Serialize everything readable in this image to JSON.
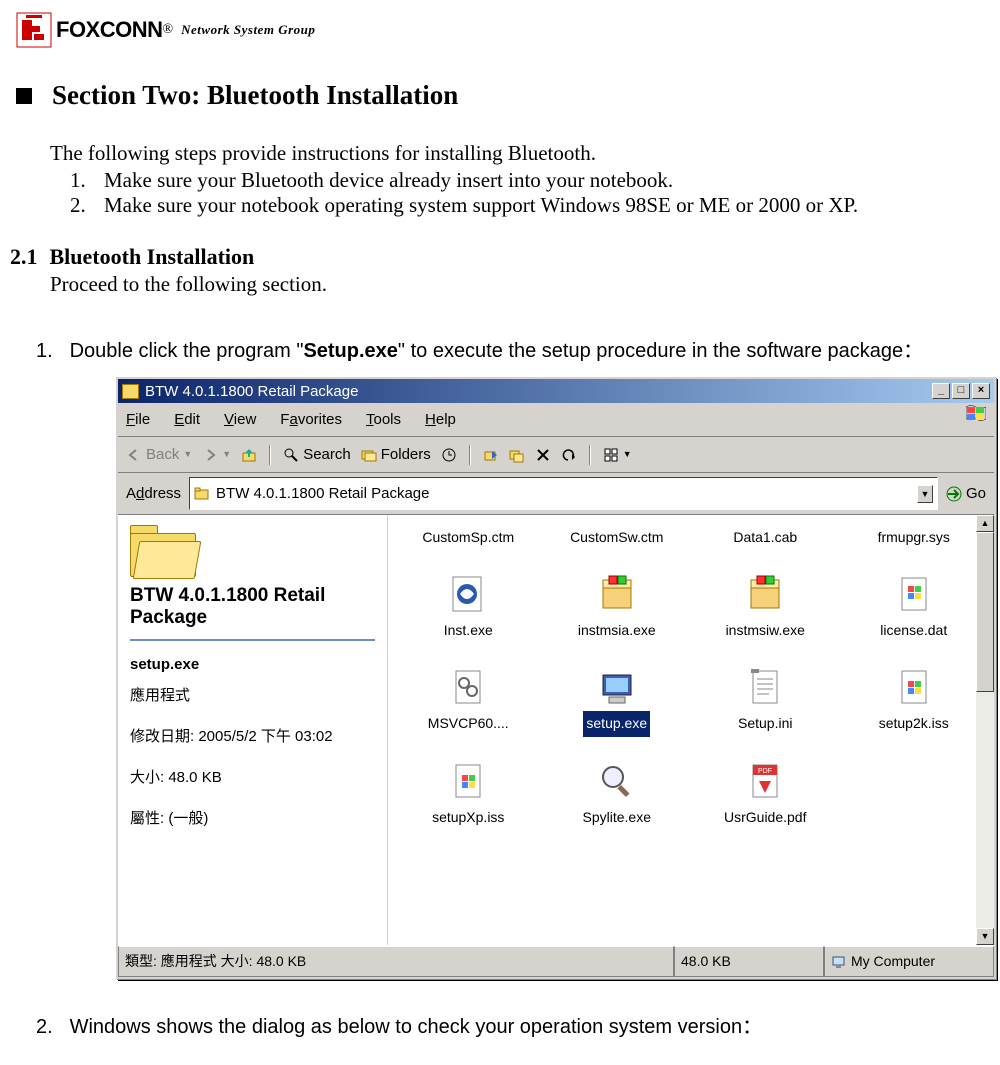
{
  "brand": {
    "name": "FOXCONN",
    "reg": "®",
    "sub": "Network  System  Group"
  },
  "section_title": "Section Two: Bluetooth Installation",
  "intro": "The following steps provide instructions for installing Bluetooth.",
  "prechecks": [
    {
      "n": "1.",
      "t": "Make sure your Bluetooth device already insert into your notebook."
    },
    {
      "n": "2.",
      "t": "Make sure your notebook operating system support Windows 98SE or ME or 2000 or XP."
    }
  ],
  "sub": {
    "num": "2.1",
    "title": "Bluetooth Installation",
    "proceed": "Proceed to the following section."
  },
  "steps": {
    "one": {
      "n": "1.",
      "pre": "Double click the program \"",
      "strong": "Setup.exe",
      "post": "\" to execute the setup procedure in the software package："
    },
    "two": {
      "n": "2.",
      "t": "Windows shows the dialog as below to check your operation system version："
    }
  },
  "win": {
    "title": "BTW 4.0.1.1800 Retail Package",
    "window_buttons": {
      "min": "_",
      "max": "□",
      "close": "×"
    },
    "menus": [
      "File",
      "Edit",
      "View",
      "Favorites",
      "Tools",
      "Help"
    ],
    "toolbar": {
      "back": "Back",
      "search": "Search",
      "folders": "Folders"
    },
    "address": {
      "label": "Address",
      "path": "BTW 4.0.1.1800 Retail Package",
      "go": "Go",
      "drop": "▼"
    },
    "sidepanel": {
      "folder_name": "BTW 4.0.1.1800 Retail Package",
      "sel_name": "setup.exe",
      "sel_type": "應用程式",
      "mod_label": "修改日期: 2005/5/2 下午 03:02",
      "size_label": "大小: 48.0 KB",
      "attr_label": "屬性: (一般)"
    },
    "files_row1": [
      "CustomSp.ctm",
      "CustomSw.ctm",
      "Data1.cab",
      "frmupgr.sys"
    ],
    "files_row2": [
      "Inst.exe",
      "instmsia.exe",
      "instmsiw.exe",
      "license.dat"
    ],
    "files_row3": [
      "MSVCP60....",
      "setup.exe",
      "Setup.ini",
      "setup2k.iss"
    ],
    "files_row4": [
      "setupXp.iss",
      "Spylite.exe",
      "UsrGuide.pdf",
      ""
    ],
    "selected": "setup.exe",
    "status": {
      "type": "類型: 應用程式 大小: 48.0 KB",
      "size": "48.0 KB",
      "location": "My Computer"
    },
    "scroll": {
      "up": "▲",
      "down": "▼"
    }
  }
}
